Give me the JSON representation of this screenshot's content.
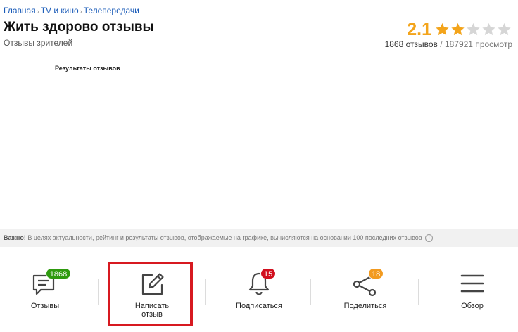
{
  "breadcrumb": {
    "items": [
      "Главная",
      "TV и кино",
      "Телепередачи"
    ],
    "separator": "›"
  },
  "page": {
    "title": "Жить здорово отзывы",
    "subtitle": "Отзывы зрителей"
  },
  "rating": {
    "value": "2.1",
    "stars_filled": 2,
    "stars_total": 5,
    "reviews_count": "1868 отзывов",
    "separator": " / ",
    "views_count": "187921 просмотр",
    "star_color": "#f3a41b",
    "star_empty_color": "#d6d6d6"
  },
  "results": {
    "title": "Результаты отзывов"
  },
  "notice": {
    "bold": "Важно!",
    "text": " В целях актуальности, рейтинг и результаты отзывов, отображаемые на графике, вычисляются на основании 100 последних отзывов",
    "icon": "info-icon"
  },
  "bottom_bar": {
    "reviews": {
      "label": "Отзывы",
      "badge": "1868",
      "badge_color": "#2e9a0e",
      "icon": "comment-icon"
    },
    "write": {
      "label_line1": "Написать",
      "label_line2": "отзыв",
      "icon": "edit-icon"
    },
    "subscribe": {
      "label": "Подписаться",
      "badge": "15",
      "badge_color": "#d10f1e",
      "icon": "bell-icon"
    },
    "share": {
      "label": "Поделиться",
      "badge": "18",
      "badge_color": "#f29a1f",
      "icon": "share-icon"
    },
    "overview": {
      "label": "Обзор",
      "icon": "menu-icon"
    }
  },
  "highlight_color": "#d71920"
}
